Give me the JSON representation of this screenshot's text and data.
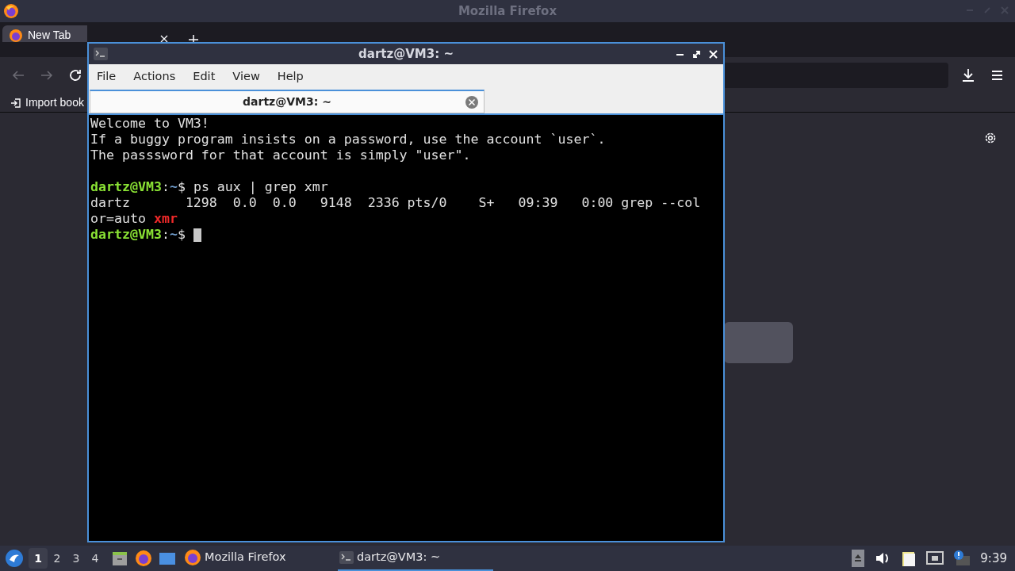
{
  "firefox": {
    "title": "Mozilla Firefox",
    "tabs": [
      {
        "label": "New Tab",
        "selected": true
      }
    ],
    "bookmarks": [
      {
        "label": "Import book"
      }
    ]
  },
  "terminal": {
    "title": "dartz@VM3: ~",
    "menu": [
      "File",
      "Actions",
      "Edit",
      "View",
      "Help"
    ],
    "tabs": [
      {
        "label": "dartz@VM3: ~",
        "selected": true
      }
    ],
    "lines": [
      [
        {
          "kind": "text",
          "text": "Welcome to VM3!"
        }
      ],
      [
        {
          "kind": "text",
          "text": "If a buggy program insists on a password, use the account `user`."
        }
      ],
      [
        {
          "kind": "text",
          "text": "The passsword for that account is simply \"user\"."
        }
      ],
      [
        {
          "kind": "blank"
        }
      ],
      [
        {
          "kind": "user",
          "text": "dartz@VM3"
        },
        {
          "kind": "text",
          "text": ":"
        },
        {
          "kind": "path",
          "text": "~"
        },
        {
          "kind": "text",
          "text": "$ ps aux | grep xmr"
        }
      ],
      [
        {
          "kind": "text",
          "text": "dartz       1298  0.0  0.0   9148  2336 pts/0    S+   09:39   0:00 grep --col"
        }
      ],
      [
        {
          "kind": "text",
          "text": "or=auto "
        },
        {
          "kind": "match",
          "text": "xmr"
        }
      ],
      [
        {
          "kind": "user",
          "text": "dartz@VM3"
        },
        {
          "kind": "text",
          "text": ":"
        },
        {
          "kind": "path",
          "text": "~"
        },
        {
          "kind": "text",
          "text": "$ "
        },
        {
          "kind": "cursor"
        }
      ]
    ]
  },
  "taskbar": {
    "workspaces": [
      {
        "label": "1",
        "selected": true
      },
      {
        "label": "2",
        "selected": false
      },
      {
        "label": "3",
        "selected": false
      },
      {
        "label": "4",
        "selected": false
      }
    ],
    "tasks": [
      {
        "kind": "firefox",
        "label": "Mozilla Firefox",
        "selected": false
      },
      {
        "kind": "terminal",
        "label": "dartz@VM3: ~",
        "selected": true
      }
    ],
    "clock": "9:39"
  }
}
